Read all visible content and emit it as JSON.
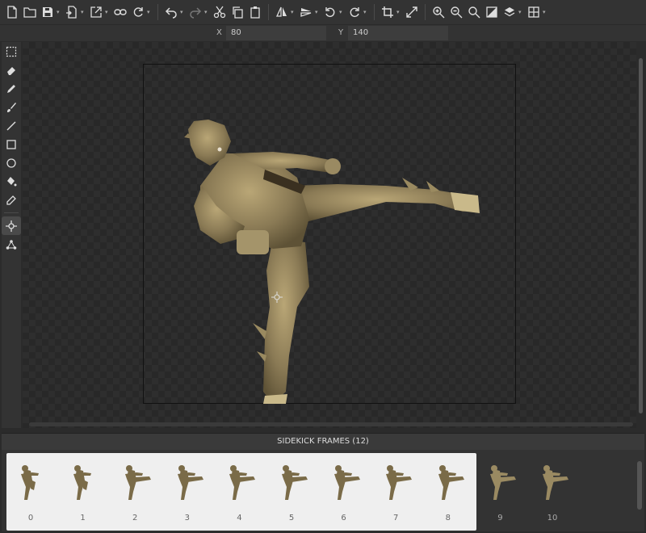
{
  "toolbar": {
    "groups": [
      [
        "new-file-icon",
        "open-folder-icon",
        "save-icon",
        "export-file-icon",
        "open-external-icon",
        "link-icon",
        "refresh-icon"
      ],
      [
        "undo-icon",
        "redo-icon",
        "cut-icon",
        "copy-icon",
        "paste-icon"
      ],
      [
        "flip-horizontal-icon",
        "flip-vertical-icon",
        "rotate-left-icon",
        "rotate-right-icon"
      ],
      [
        "crop-icon",
        "resize-icon"
      ],
      [
        "zoom-in-icon",
        "zoom-out-icon",
        "zoom-fit-icon",
        "contrast-icon",
        "layers-icon",
        "grid-icon"
      ]
    ]
  },
  "coords": {
    "x_label": "X",
    "x_value": "80",
    "y_label": "Y",
    "y_value": "140"
  },
  "tools": [
    "selection-icon",
    "eraser-icon",
    "pencil-icon",
    "brush-icon",
    "line-icon",
    "rectangle-icon",
    "ellipse-icon",
    "fill-icon",
    "eyedropper-icon",
    "origin-icon",
    "skeleton-icon"
  ],
  "frames": {
    "title": "SIDEKICK FRAMES (12)",
    "items": [
      {
        "label": "0"
      },
      {
        "label": "1"
      },
      {
        "label": "2"
      },
      {
        "label": "3"
      },
      {
        "label": "4"
      },
      {
        "label": "5"
      },
      {
        "label": "6"
      },
      {
        "label": "7"
      },
      {
        "label": "8"
      },
      {
        "label": "9"
      },
      {
        "label": "10"
      }
    ]
  },
  "colors": {
    "sprite_main": "#8a7a55",
    "sprite_dark": "#5e5236",
    "sprite_light": "#c9b98a",
    "strip_bg": "#efefef"
  }
}
